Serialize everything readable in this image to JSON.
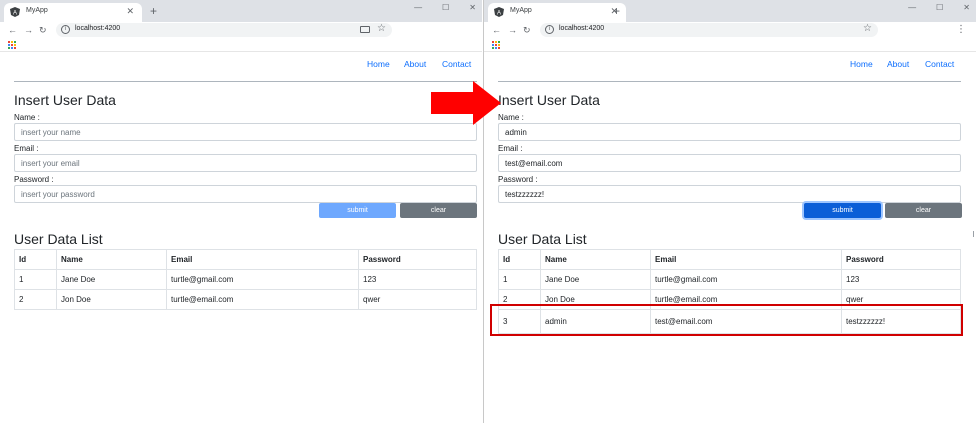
{
  "left": {
    "tab_title": "MyApp",
    "url": "localhost:4200",
    "nav": [
      "Home",
      "About",
      "Contact"
    ],
    "form": {
      "title": "Insert User Data",
      "name_label": "Name :",
      "name_value": "",
      "name_placeholder": "insert your name",
      "email_label": "Email :",
      "email_value": "",
      "email_placeholder": "insert your email",
      "password_label": "Password :",
      "password_value": "",
      "password_placeholder": "insert your password",
      "submit_label": "submit",
      "clear_label": "clear"
    },
    "list": {
      "title": "User Data List",
      "columns": [
        "Id",
        "Name",
        "Email",
        "Password"
      ],
      "rows": [
        [
          "1",
          "Jane Doe",
          "turtle@gmail.com",
          "123"
        ],
        [
          "2",
          "Jon Doe",
          "turtle@email.com",
          "qwer"
        ]
      ]
    }
  },
  "right": {
    "tab_title": "MyApp",
    "url": "localhost:4200",
    "nav": [
      "Home",
      "About",
      "Contact"
    ],
    "form": {
      "title": "Insert User Data",
      "name_label": "Name :",
      "name_value": "admin",
      "email_label": "Email :",
      "email_value": "test@email.com",
      "password_label": "Password :",
      "password_value": "testzzzzzz!",
      "submit_label": "submit",
      "clear_label": "clear"
    },
    "list": {
      "title": "User Data List",
      "columns": [
        "Id",
        "Name",
        "Email",
        "Password"
      ],
      "rows": [
        [
          "1",
          "Jane Doe",
          "turtle@gmail.com",
          "123"
        ],
        [
          "2",
          "Jon Doe",
          "turtle@email.com",
          "qwer"
        ],
        [
          "3",
          "admin",
          "test@email.com",
          "testzzzzzz!"
        ]
      ]
    }
  },
  "annotation": {
    "arrow_color": "#ff0000",
    "highlight_color": "#d00000"
  }
}
